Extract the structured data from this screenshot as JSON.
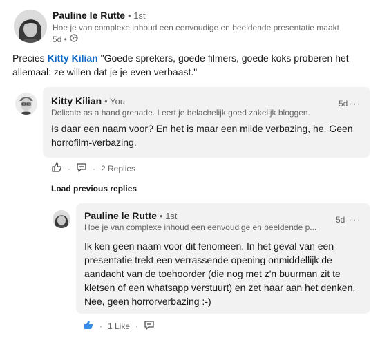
{
  "post": {
    "author": "Pauline le Rutte",
    "degree": "• 1st",
    "headline": "Hoe je van complexe inhoud een eenvoudige en beeldende presentatie maakt",
    "age": "5d •",
    "text_prefix": "Precies ",
    "mention": "Kitty Kilian",
    "text_suffix": " \"Goede sprekers, goede filmers, goede koks proberen het allemaal: ze willen dat je je even verbaast.\""
  },
  "comment": {
    "author": "Kitty Kilian",
    "degree": "• You",
    "headline": "Delicate as a hand grenade. Leert je belachelijk goed zakelijk bloggen.",
    "time": "5d",
    "more": "···",
    "text": "Is daar een naam voor? En het is maar een milde verbazing, he. Geen horrofilm-verbazing.",
    "replies": "2 Replies",
    "sep": "·"
  },
  "load_previous": "Load previous replies",
  "reply": {
    "author": "Pauline le Rutte",
    "degree": "• 1st",
    "headline": "Hoe je van complexe inhoud een eenvoudige en beeldende p...",
    "time": "5d",
    "more": "···",
    "text": "Ik ken geen naam voor dit fenomeen. In het geval van een presentatie trekt een verrassende opening onmiddellijk de aandacht van de toehoorder (die nog met z'n buurman zit te kletsen of een whatsapp verstuurt) en zet haar aan het denken. Nee, geen horrorverbazing :-)",
    "likes": "1 Like",
    "sep": "·"
  },
  "colors": {
    "accent": "#0a66c2",
    "bubble": "#f2f2f2",
    "like_active": "#378fe9"
  },
  "icons": {
    "globe": "globe-icon",
    "like": "like-icon",
    "comment": "comment-icon",
    "more": "more-icon"
  }
}
